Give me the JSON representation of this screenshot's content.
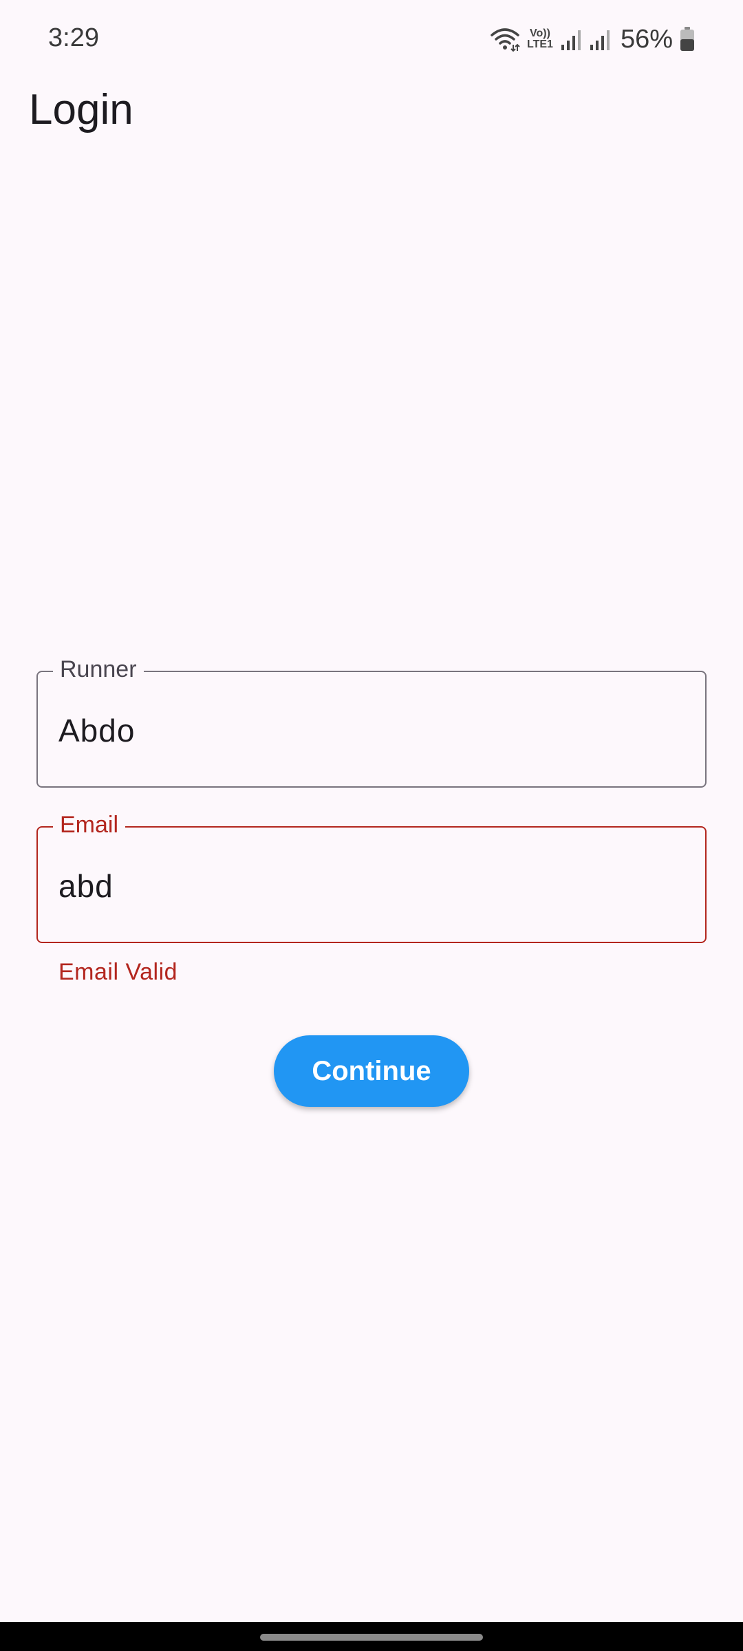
{
  "status_bar": {
    "time": "3:29",
    "volte_top": "Vo))",
    "volte_bottom": "LTE1",
    "battery_percent": "56%",
    "icons": [
      "wifi-icon",
      "volte-icon",
      "signal-icon",
      "signal-icon",
      "battery-icon"
    ]
  },
  "app_bar": {
    "title": "Login"
  },
  "form": {
    "runner": {
      "label": "Runner",
      "value": "Abdo"
    },
    "email": {
      "label": "Email",
      "value": "abd",
      "error": "Email Valid"
    },
    "continue_label": "Continue"
  },
  "colors": {
    "background": "#fdf8fc",
    "error": "#b3261e",
    "outline": "#79747e",
    "button": "#2196f3"
  }
}
